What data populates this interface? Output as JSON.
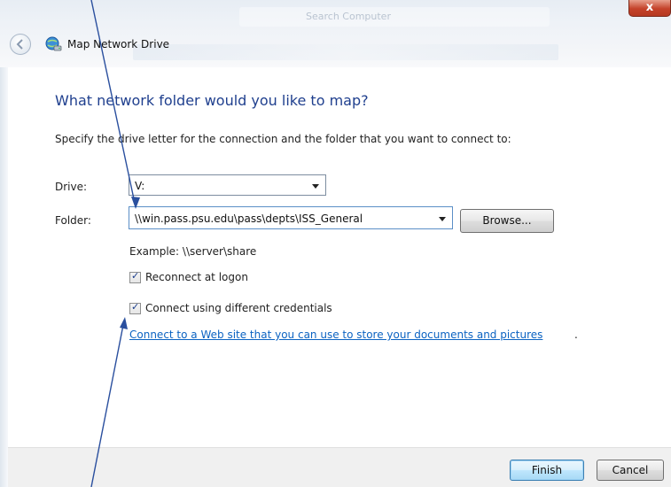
{
  "window": {
    "title": "Map Network Drive",
    "close_label": "x",
    "background_search_text": "Search Computer"
  },
  "wizard": {
    "heading": "What network folder would you like to map?",
    "instructions": "Specify the drive letter for the connection and the folder that you want to connect to:",
    "drive": {
      "label": "Drive:",
      "value": "V:"
    },
    "folder": {
      "label": "Folder:",
      "value": "\\\\win.pass.psu.edu\\pass\\depts\\ISS_General"
    },
    "browse_label": "Browse...",
    "example": "Example: \\\\server\\share",
    "reconnect": {
      "label": "Reconnect at logon",
      "checked": true
    },
    "credentials": {
      "label": "Connect using different credentials",
      "checked": true
    },
    "link_text": "Connect to a Web site that you can use to store your documents and pictures",
    "link_suffix": "."
  },
  "footer": {
    "finish_label": "Finish",
    "cancel_label": "Cancel"
  },
  "colors": {
    "heading": "#1f3f8e",
    "link": "#0c63c2",
    "annotation_arrow": "#2a4f9e"
  }
}
